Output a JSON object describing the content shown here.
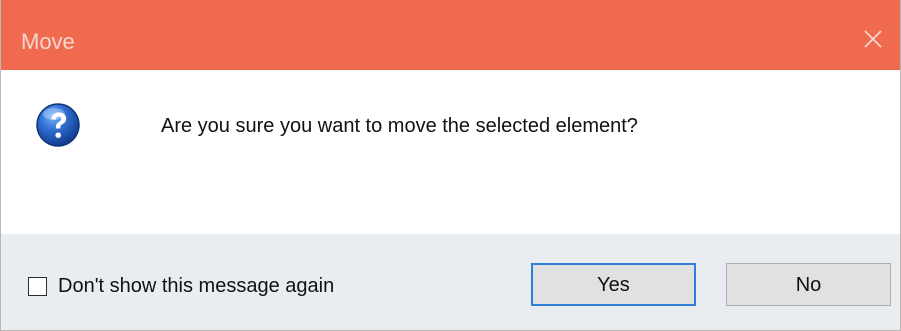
{
  "dialog": {
    "title": "Move",
    "message": "Are you sure you want to move the selected element?",
    "checkbox_label": "Don't show this message again",
    "checkbox_checked": false,
    "buttons": {
      "yes_label": "Yes",
      "no_label": "No"
    },
    "icons": {
      "close": "close-icon",
      "question": "question-icon"
    },
    "colors": {
      "titlebar": "#ef6a4f",
      "title_text": "#f6d7cf",
      "footer": "#e9edf2",
      "focus_border": "#2f7fd8",
      "question_blue": "#1f57b6"
    }
  }
}
